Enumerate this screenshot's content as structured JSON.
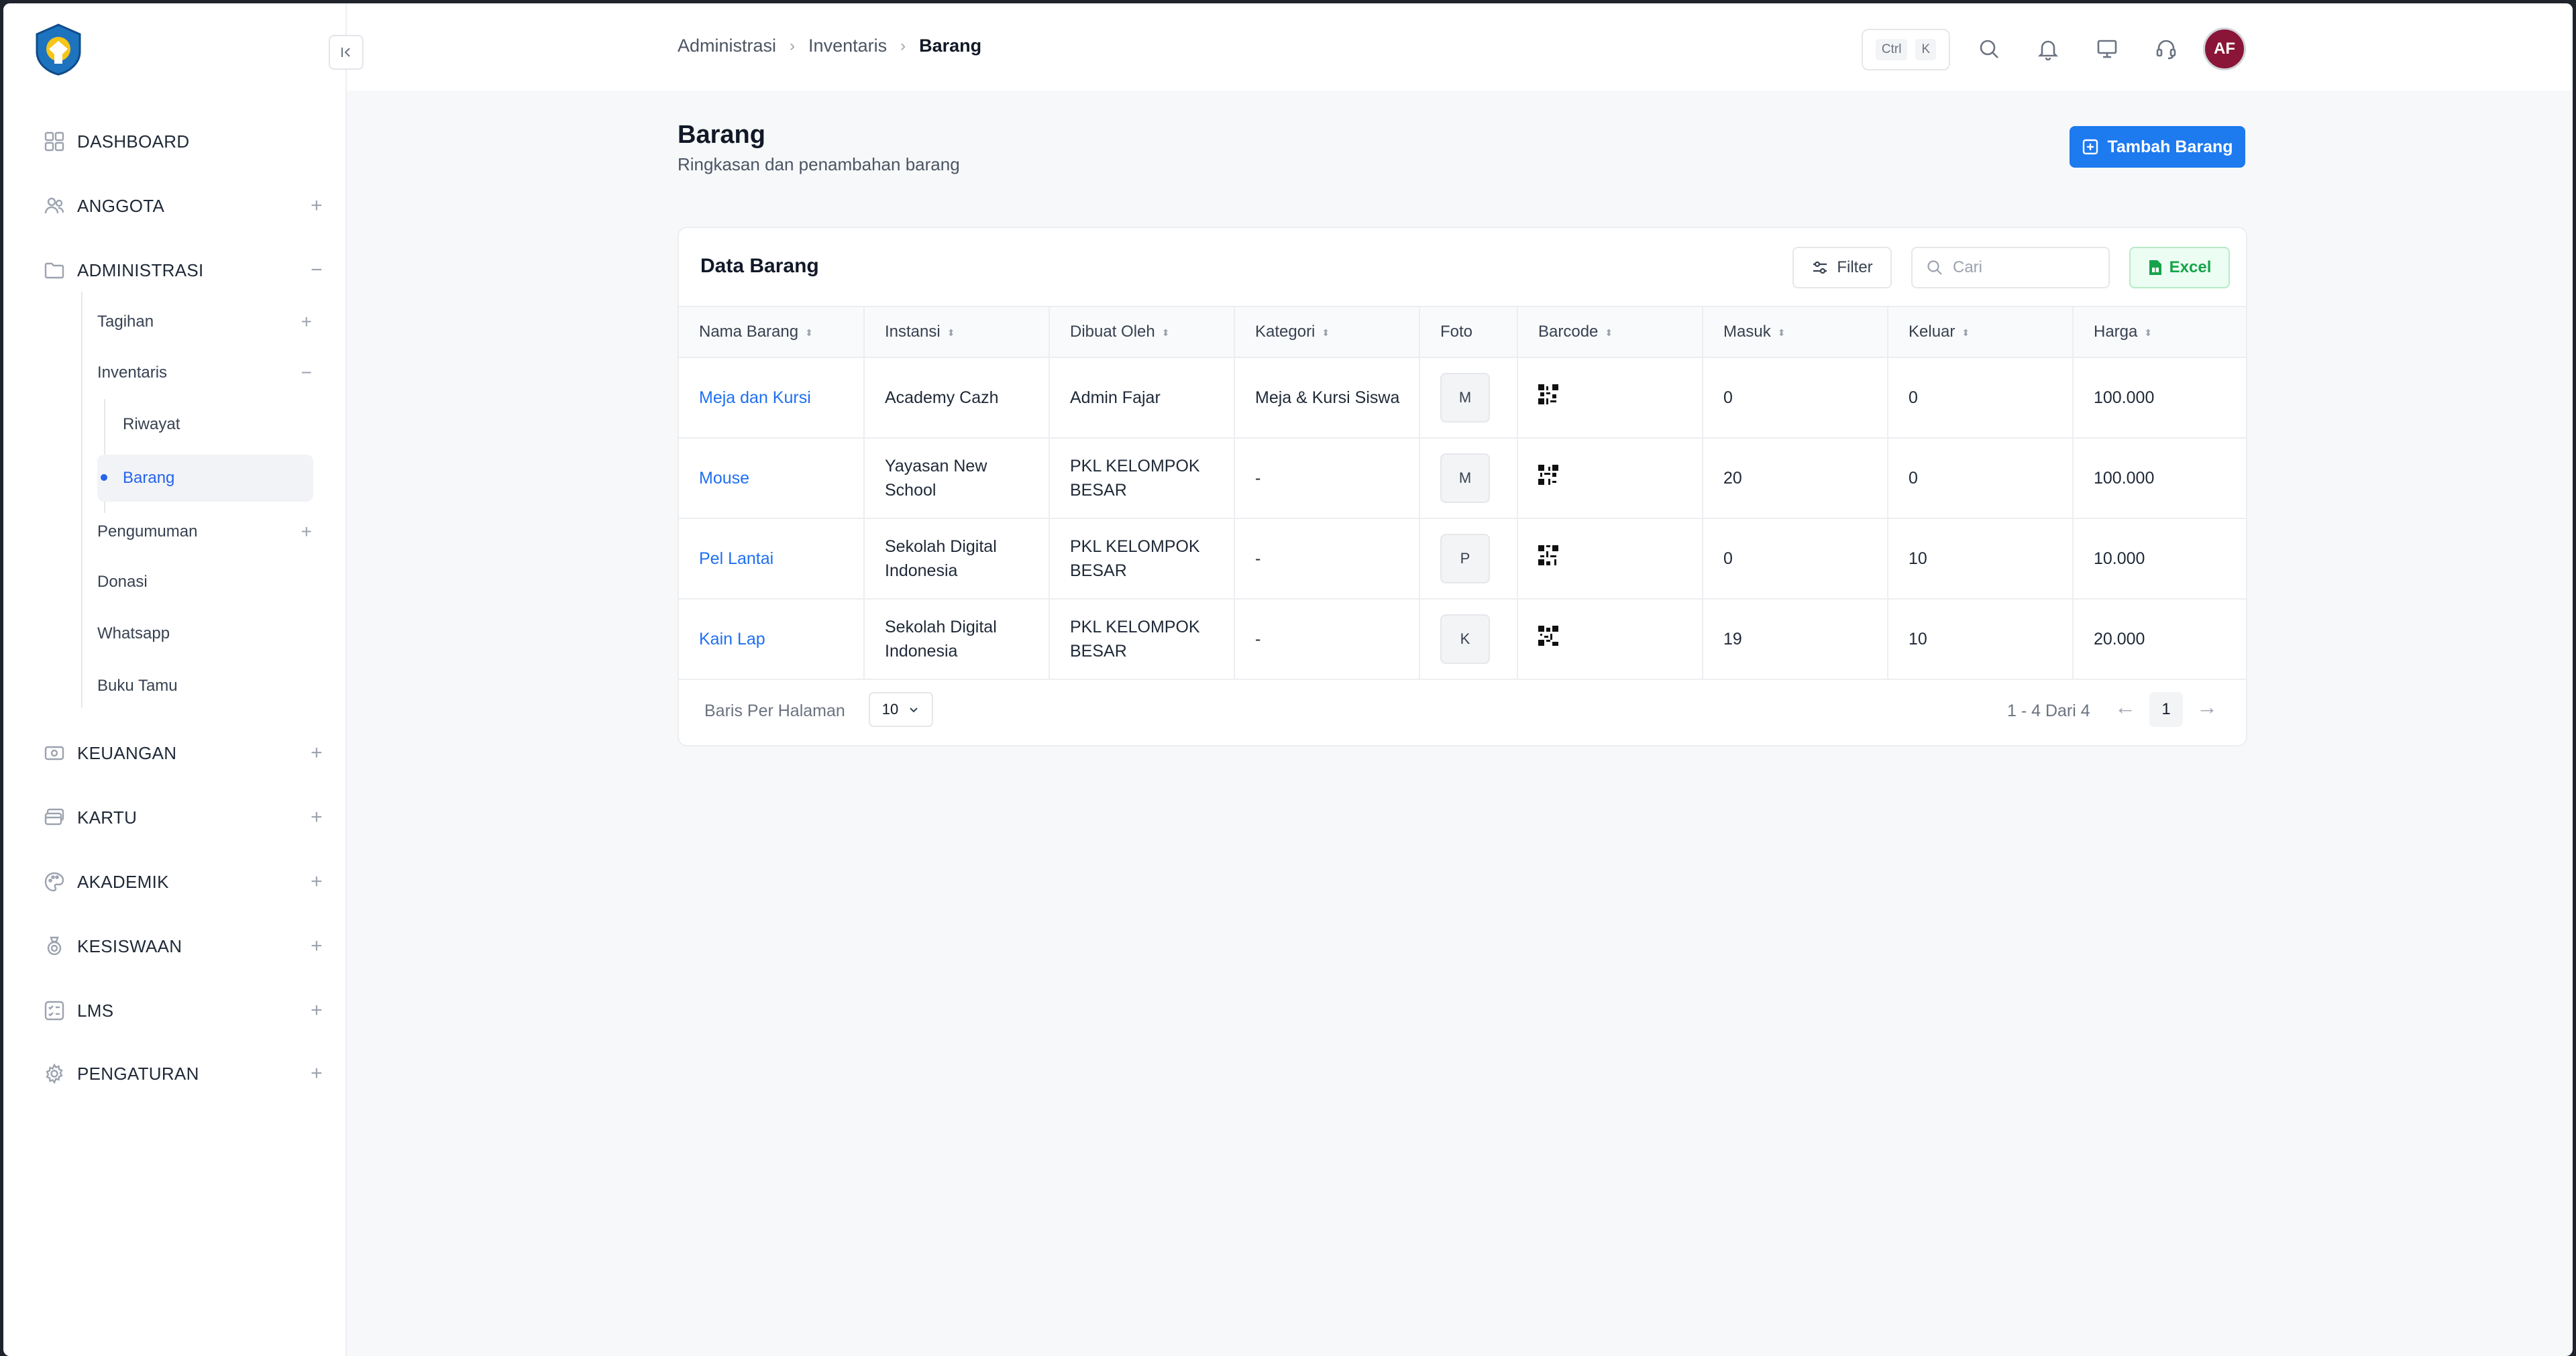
{
  "sidebar": {
    "items": [
      {
        "label": "DASHBOARD"
      },
      {
        "label": "ANGGOTA"
      },
      {
        "label": "ADMINISTRASI"
      },
      {
        "label": "KEUANGAN"
      },
      {
        "label": "KARTU"
      },
      {
        "label": "AKADEMIK"
      },
      {
        "label": "KESISWAAN"
      },
      {
        "label": "LMS"
      },
      {
        "label": "PENGATURAN"
      }
    ],
    "admin_sub": [
      {
        "label": "Tagihan"
      },
      {
        "label": "Inventaris"
      },
      {
        "label": "Pengumuman"
      },
      {
        "label": "Donasi"
      },
      {
        "label": "Whatsapp"
      },
      {
        "label": "Buku Tamu"
      }
    ],
    "inventaris_sub": [
      {
        "label": "Riwayat"
      },
      {
        "label": "Barang"
      }
    ]
  },
  "breadcrumb": [
    "Administrasi",
    "Inventaris",
    "Barang"
  ],
  "shortcut": {
    "ctrl": "Ctrl",
    "key": "K"
  },
  "avatar": "AF",
  "page": {
    "title": "Barang",
    "subtitle": "Ringkasan dan penambahan barang",
    "add_button": "Tambah Barang"
  },
  "card": {
    "title": "Data Barang",
    "filter": "Filter",
    "search_placeholder": "Cari",
    "excel": "Excel"
  },
  "table": {
    "headers": [
      "Nama Barang",
      "Instansi",
      "Dibuat Oleh",
      "Kategori",
      "Foto",
      "Barcode",
      "Masuk",
      "Keluar",
      "Harga"
    ],
    "rows": [
      {
        "nama": "Meja dan Kursi",
        "instansi": "Academy Cazh",
        "dibuat": "Admin Fajar",
        "kategori": "Meja & Kursi Siswa",
        "foto": "M",
        "masuk": "0",
        "keluar": "0",
        "harga": "100.000"
      },
      {
        "nama": "Mouse",
        "instansi": "Yayasan New School",
        "dibuat": "PKL KELOMPOK BESAR",
        "kategori": "-",
        "foto": "M",
        "masuk": "20",
        "keluar": "0",
        "harga": "100.000"
      },
      {
        "nama": "Pel Lantai",
        "instansi": "Sekolah Digital Indonesia",
        "dibuat": "PKL KELOMPOK BESAR",
        "kategori": "-",
        "foto": "P",
        "masuk": "0",
        "keluar": "10",
        "harga": "10.000"
      },
      {
        "nama": "Kain Lap",
        "instansi": "Sekolah Digital Indonesia",
        "dibuat": "PKL KELOMPOK BESAR",
        "kategori": "-",
        "foto": "K",
        "masuk": "19",
        "keluar": "10",
        "harga": "20.000"
      }
    ]
  },
  "pagination": {
    "rows_label": "Baris Per Halaman",
    "rows_value": "10",
    "info": "1 - 4 Dari 4",
    "current_page": "1"
  },
  "colors": {
    "accent": "#1d7aef",
    "link": "#1d6ff2",
    "excel": "#16a34a",
    "avatar": "#8a1538"
  }
}
